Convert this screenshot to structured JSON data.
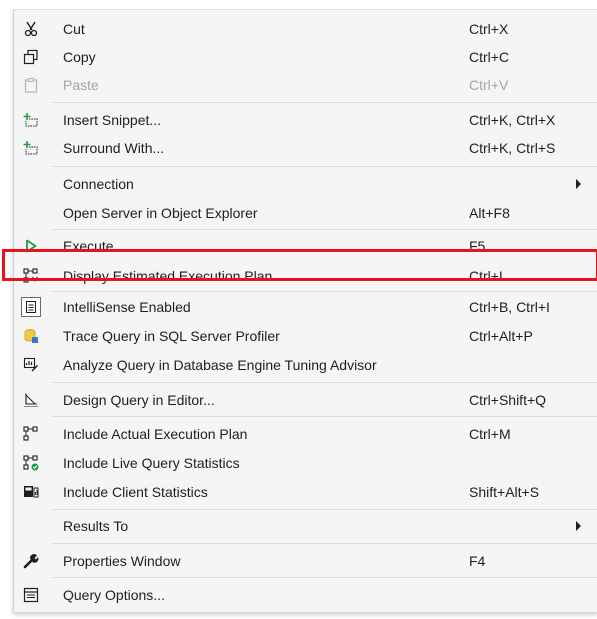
{
  "menu": {
    "items": [
      {
        "label": "Cut",
        "shortcut": "Ctrl+X",
        "icon": "scissors-icon"
      },
      {
        "label": "Copy",
        "shortcut": "Ctrl+C",
        "icon": "copy-icon"
      },
      {
        "label": "Paste",
        "shortcut": "Ctrl+V",
        "icon": "paste-icon",
        "disabled": true
      },
      {
        "label": "Insert Snippet...",
        "shortcut": "Ctrl+K, Ctrl+X",
        "icon": "insert-snippet-icon"
      },
      {
        "label": "Surround With...",
        "shortcut": "Ctrl+K, Ctrl+S",
        "icon": "surround-with-icon"
      },
      {
        "label": "Connection",
        "shortcut": "",
        "submenu": true
      },
      {
        "label": "Open Server in Object Explorer",
        "shortcut": "Alt+F8"
      },
      {
        "label": "Execute",
        "shortcut": "F5",
        "icon": "play-icon"
      },
      {
        "label": "Display Estimated Execution Plan",
        "shortcut": "Ctrl+L",
        "icon": "execution-plan-icon",
        "highlighted": true
      },
      {
        "label": "IntelliSense Enabled",
        "shortcut": "Ctrl+B, Ctrl+I",
        "icon": "intellisense-icon"
      },
      {
        "label": "Trace Query in SQL Server Profiler",
        "shortcut": "Ctrl+Alt+P",
        "icon": "profiler-icon"
      },
      {
        "label": "Analyze Query in Database Engine Tuning Advisor",
        "shortcut": "",
        "icon": "tuning-advisor-icon"
      },
      {
        "label": "Design Query in Editor...",
        "shortcut": "Ctrl+Shift+Q",
        "icon": "design-query-icon"
      },
      {
        "label": "Include Actual Execution Plan",
        "shortcut": "Ctrl+M",
        "icon": "actual-plan-icon"
      },
      {
        "label": "Include Live Query Statistics",
        "shortcut": "",
        "icon": "live-stats-icon"
      },
      {
        "label": "Include Client Statistics",
        "shortcut": "Shift+Alt+S",
        "icon": "client-stats-icon"
      },
      {
        "label": "Results To",
        "shortcut": "",
        "submenu": true
      },
      {
        "label": "Properties Window",
        "shortcut": "F4",
        "icon": "wrench-icon"
      },
      {
        "label": "Query Options...",
        "shortcut": "",
        "icon": "query-options-icon"
      }
    ]
  },
  "colors": {
    "highlight_border": "#e8121c",
    "accent_green": "#1e9b43",
    "menu_bg": "#f5f5f5"
  }
}
